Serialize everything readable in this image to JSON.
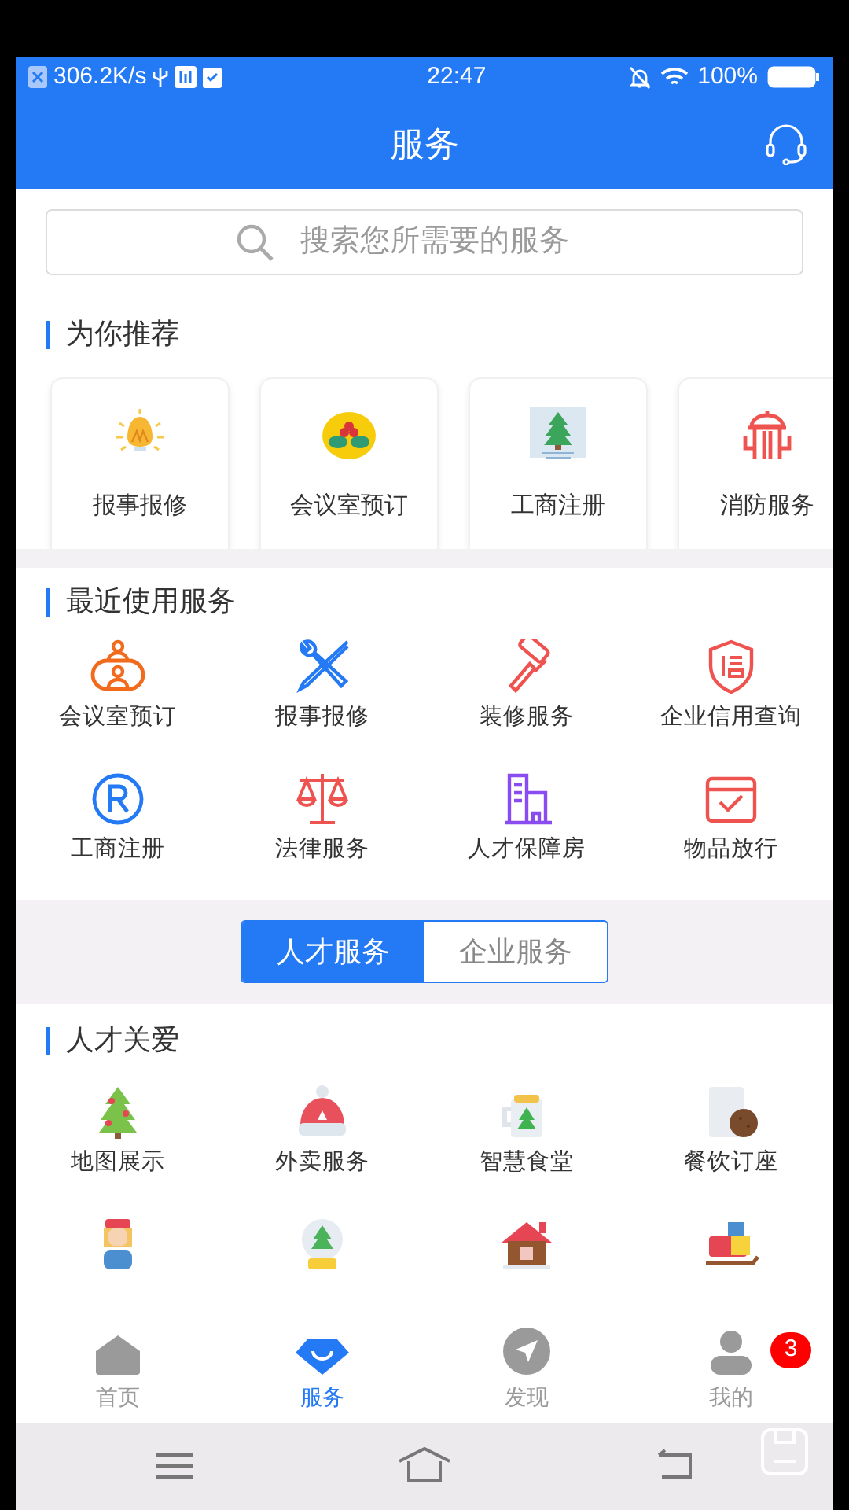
{
  "status_bar": {
    "speed": "306.2K/s",
    "time": "22:47",
    "battery": "100%"
  },
  "header": {
    "title": "服务"
  },
  "search": {
    "placeholder": "搜索您所需要的服务"
  },
  "recommended": {
    "title": "为你推荐",
    "items": [
      {
        "label": "报事报修"
      },
      {
        "label": "会议室预订"
      },
      {
        "label": "工商注册"
      },
      {
        "label": "消防服务"
      }
    ]
  },
  "recent": {
    "title": "最近使用服务",
    "items": [
      {
        "label": "会议室预订"
      },
      {
        "label": "报事报修"
      },
      {
        "label": "装修服务"
      },
      {
        "label": "企业信用查询"
      },
      {
        "label": "工商注册"
      },
      {
        "label": "法律服务"
      },
      {
        "label": "人才保障房"
      },
      {
        "label": "物品放行"
      }
    ]
  },
  "segments": [
    {
      "label": "人才服务",
      "selected": true
    },
    {
      "label": "企业服务",
      "selected": false
    }
  ],
  "care": {
    "title": "人才关爱",
    "items": [
      {
        "label": "地图展示"
      },
      {
        "label": "外卖服务"
      },
      {
        "label": "智慧食堂"
      },
      {
        "label": "餐饮订座"
      },
      {
        "kind": "picture"
      },
      {
        "kind": "picture"
      },
      {
        "kind": "picture"
      },
      {
        "kind": "picture"
      }
    ]
  },
  "tab_bar": [
    {
      "label": "首页",
      "selected": false
    },
    {
      "label": "服务",
      "selected": true
    },
    {
      "label": "发现",
      "selected": false
    },
    {
      "label": "我的",
      "selected": false,
      "badge": "3"
    }
  ]
}
